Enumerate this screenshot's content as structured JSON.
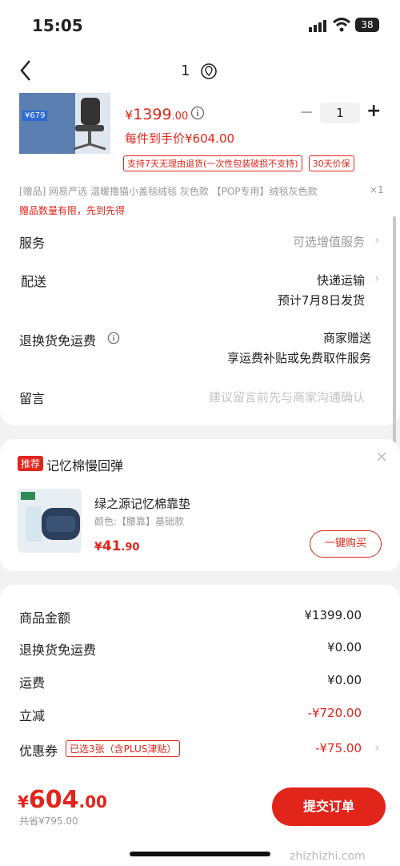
{
  "status": {
    "time": "15:05",
    "battery": "38"
  },
  "nav": {
    "title": "1"
  },
  "product": {
    "price_symbol": "¥",
    "price_int": "1399",
    "price_dec": ".00",
    "each_label": "每件到手价¥604.00",
    "quantity": "1",
    "tag_return": "支持7天无理由退货(一次性包装破损不支持)",
    "tag_price": "30天价保",
    "thumb_price": "¥679"
  },
  "gift": {
    "text": "[赠品] 网易严选 温暖撸猫小盖毯绒毯 灰色款 【POP专用】绒毯灰色款",
    "count": "×1",
    "notice": "赠品数量有限，先到先得"
  },
  "rows": {
    "service_label": "服务",
    "service_value": "可选增值服务",
    "delivery_label": "配送",
    "delivery_value": "快递运输",
    "delivery_date": "预计7月8日发货",
    "return_label": "退换货免运费",
    "return_value": "商家赠送",
    "return_sub": "享运费补贴或免费取件服务",
    "message_label": "留言",
    "message_placeholder": "建议留言前先与商家沟通确认"
  },
  "recommend": {
    "badge": "推荐",
    "title": "记忆棉慢回弹",
    "item_name": "绿之源记忆棉靠垫",
    "item_spec": "颜色:【腰靠】基础款",
    "price_symbol": "¥",
    "price_int": "41",
    "price_dec": ".90",
    "buy_label": "一键购买"
  },
  "summary": {
    "goods_label": "商品金额",
    "goods_value": "¥1399.00",
    "return_fee_label": "退换货免运费",
    "return_fee_value": "¥0.00",
    "shipping_label": "运费",
    "shipping_value": "¥0.00",
    "discount_label": "立减",
    "discount_value": "-¥720.00",
    "coupon_label": "优惠券",
    "coupon_tag": "已选3张（含PLUS津贴）",
    "coupon_value": "-¥75.00"
  },
  "bottom": {
    "total_symbol": "¥",
    "total_int": "604",
    "total_dec": ".00",
    "saved": "共省¥795.00",
    "submit_label": "提交订单",
    "watermark": "zhizhizhi.com"
  },
  "colors": {
    "accent": "#e1251b"
  }
}
